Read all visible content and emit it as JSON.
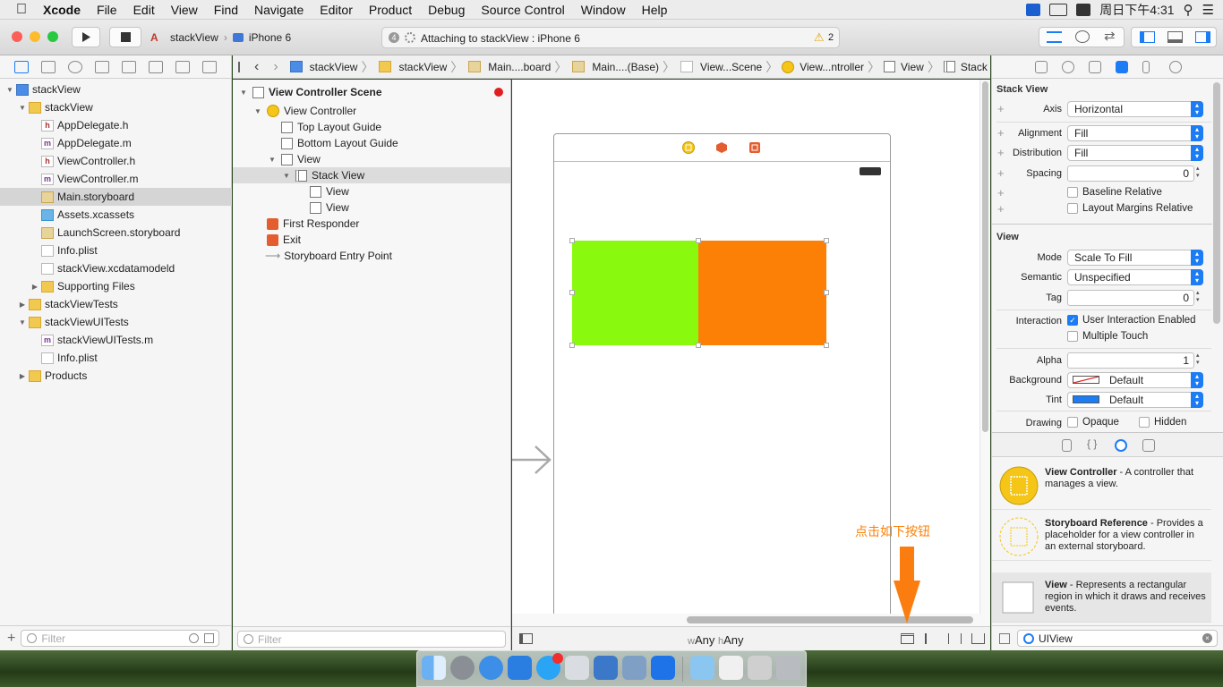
{
  "menubar": {
    "apple": "",
    "app_name": "Xcode",
    "items": [
      "File",
      "Edit",
      "View",
      "Find",
      "Navigate",
      "Editor",
      "Product",
      "Debug",
      "Source Control",
      "Window",
      "Help"
    ],
    "clock": "周日下午4:31"
  },
  "toolbar": {
    "scheme_target": "stackView",
    "scheme_device": "iPhone 6",
    "activity_count": "4",
    "activity_text": "Attaching to stackView : iPhone 6",
    "warning_count": "2"
  },
  "navigator": {
    "items": [
      {
        "label": "stackView",
        "icon": "proj"
      },
      {
        "label": "stackView",
        "icon": "folder"
      },
      {
        "label": "AppDelegate.h",
        "icon": "h"
      },
      {
        "label": "AppDelegate.m",
        "icon": "m"
      },
      {
        "label": "ViewController.h",
        "icon": "h"
      },
      {
        "label": "ViewController.m",
        "icon": "m"
      },
      {
        "label": "Main.storyboard",
        "icon": "sb"
      },
      {
        "label": "Assets.xcassets",
        "icon": "xa"
      },
      {
        "label": "LaunchScreen.storyboard",
        "icon": "sb"
      },
      {
        "label": "Info.plist",
        "icon": "plist"
      },
      {
        "label": "stackView.xcdatamodeld",
        "icon": "plist"
      },
      {
        "label": "Supporting Files",
        "icon": "folder"
      },
      {
        "label": "stackViewTests",
        "icon": "folder"
      },
      {
        "label": "stackViewUITests",
        "icon": "folder"
      },
      {
        "label": "stackViewUITests.m",
        "icon": "m"
      },
      {
        "label": "Info.plist",
        "icon": "plist"
      },
      {
        "label": "Products",
        "icon": "folder"
      }
    ],
    "filter_placeholder": "Filter"
  },
  "jumpbar": {
    "crumbs": [
      "stackView",
      "stackView",
      "Main....board",
      "Main....(Base)",
      "View...Scene",
      "View...ntroller",
      "View",
      "Stack View"
    ]
  },
  "outline": {
    "items": [
      {
        "label": "View Controller Scene"
      },
      {
        "label": "View Controller"
      },
      {
        "label": "Top Layout Guide"
      },
      {
        "label": "Bottom Layout Guide"
      },
      {
        "label": "View"
      },
      {
        "label": "Stack View"
      },
      {
        "label": "View"
      },
      {
        "label": "View"
      },
      {
        "label": "First Responder"
      },
      {
        "label": "Exit"
      },
      {
        "label": "Storyboard Entry Point"
      }
    ],
    "filter_placeholder": "Filter"
  },
  "canvas": {
    "colors": {
      "left_view": "#89fa0e",
      "right_view": "#fd8006"
    },
    "annotation": "点击如下按钮",
    "size_class_w_prefix": "w",
    "size_class_w": "Any",
    "size_class_h_prefix": "h",
    "size_class_h": "Any"
  },
  "inspector": {
    "stack_header": "Stack View",
    "axis_label": "Axis",
    "axis_value": "Horizontal",
    "alignment_label": "Alignment",
    "alignment_value": "Fill",
    "distribution_label": "Distribution",
    "distribution_value": "Fill",
    "spacing_label": "Spacing",
    "spacing_value": "0",
    "baseline_label": "Baseline Relative",
    "layout_margins_label": "Layout Margins Relative",
    "view_header": "View",
    "mode_label": "Mode",
    "mode_value": "Scale To Fill",
    "semantic_label": "Semantic",
    "semantic_value": "Unspecified",
    "tag_label": "Tag",
    "tag_value": "0",
    "interaction_label": "Interaction",
    "user_interaction_label": "User Interaction Enabled",
    "multiple_touch_label": "Multiple Touch",
    "alpha_label": "Alpha",
    "alpha_value": "1",
    "background_label": "Background",
    "background_value": "Default",
    "tint_label": "Tint",
    "tint_value": "Default",
    "drawing_label": "Drawing",
    "opaque_label": "Opaque",
    "hidden_label": "Hidden"
  },
  "library": {
    "items": [
      {
        "title": "View Controller",
        "desc": " - A controller that manages a view."
      },
      {
        "title": "Storyboard Reference",
        "desc": " - Provides a placeholder for a view controller in an external storyboard."
      },
      {
        "title": "View",
        "desc": " - Represents a rectangular region in which it draws and receives events."
      }
    ],
    "search_value": "UIView"
  }
}
